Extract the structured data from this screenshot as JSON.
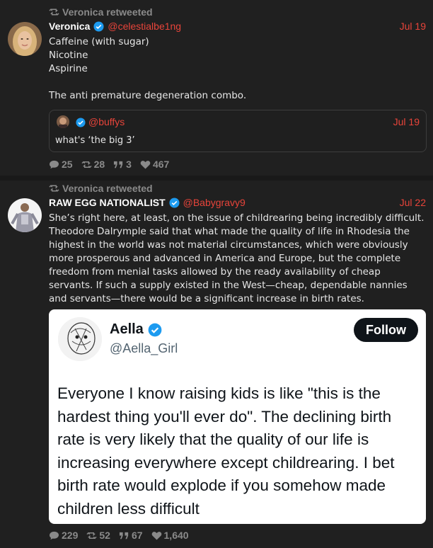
{
  "colors": {
    "accent": "#e8443a",
    "verified": "#1d9bf0",
    "muted": "#8a8a8a",
    "background": "#202020"
  },
  "tweets": [
    {
      "retweet_label": "Veronica retweeted",
      "author_name": "Veronica",
      "verified": true,
      "handle": "@celestialbe1ng",
      "date": "Jul 19",
      "lines": [
        "Caffeine (with sugar)",
        "Nicotine",
        "Aspirine",
        "",
        "The anti premature degeneration combo."
      ],
      "quote": {
        "handle": "@buffys",
        "date": "Jul 19",
        "text": "what's ‘the big 3’"
      },
      "stats": {
        "replies": "25",
        "retweets": "28",
        "quotes": "3",
        "likes": "467"
      }
    },
    {
      "retweet_label": "Veronica retweeted",
      "author_name": "RAW EGG NATIONALIST",
      "verified": true,
      "handle": "@Babygravy9",
      "date": "Jul 22",
      "text": "She’s right here, at least, on the issue of childrearing being incredibly difficult. Theodore Dalrymple said that what made the quality of life in Rhodesia the highest in the world was not material circumstances, which were obviously more prosperous and advanced in America and Europe, but the complete freedom from menial tasks allowed by the ready availability of cheap servants. If such a supply existed in the West—cheap, dependable nannies and servants—there would be a significant increase in birth rates.",
      "embed": {
        "name": "Aella",
        "handle": "@Aella_Girl",
        "follow_label": "Follow",
        "text": "Everyone I know raising kids is like \"this is the hardest thing you'll ever do\". The declining birth rate is very likely that the quality of our life is increasing everywhere except childrearing. I bet birth rate would explode if you somehow made children less difficult"
      },
      "stats": {
        "replies": "229",
        "retweets": "52",
        "quotes": "67",
        "likes": "1,640"
      }
    }
  ]
}
